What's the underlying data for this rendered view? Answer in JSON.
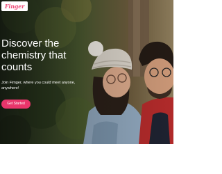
{
  "brand": {
    "logo_text": "Finger",
    "accent_color": "#e9356b"
  },
  "hero": {
    "headline": "Discover the chemistry that counts",
    "subtext": "Join Fimger, where you could meet anyone, anywhere!",
    "cta_label": "Get Started"
  }
}
